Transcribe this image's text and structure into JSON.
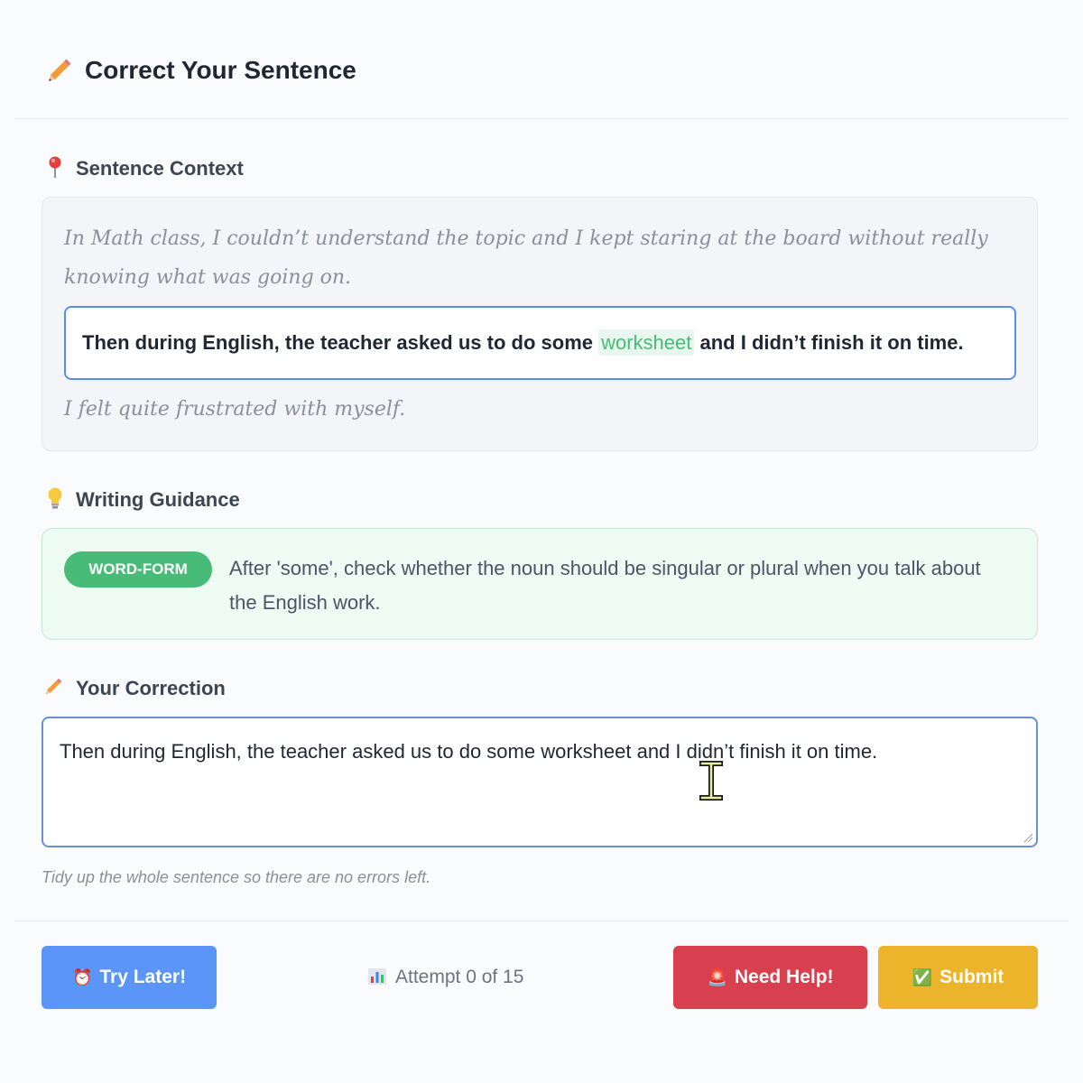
{
  "header": {
    "title": "Correct Your Sentence",
    "icon": "pencil-icon"
  },
  "context": {
    "label": "Sentence Context",
    "icon": "pin-icon",
    "before": "In Math class, I couldn’t understand the topic and I kept staring at the board without really knowing what was going on.",
    "target_start": "Then during English, the teacher asked us to do some ",
    "target_highlight": "worksheet",
    "target_end": " and I didn’t finish it on time.",
    "after": "I felt quite frustrated with myself."
  },
  "guidance": {
    "label": "Writing Guidance",
    "icon": "lightbulb-icon",
    "badge": "WORD-FORM",
    "text": "After 'some', check whether the noun should be singular or plural when you talk about the English work."
  },
  "correction": {
    "label": "Your Correction",
    "icon": "pencil-icon",
    "value": "Then during English, the teacher asked us to do some worksheet and I didn’t finish it on time.",
    "hint": "Tidy up the whole sentence so there are no errors left."
  },
  "footer": {
    "try_later": "Try Later!",
    "attempt": "Attempt 0 of 15",
    "need_help": "Need Help!",
    "submit": "Submit"
  },
  "colors": {
    "primary": "#5b95f7",
    "danger": "#d9404f",
    "warning": "#ecb42a",
    "success": "#48bb78"
  }
}
